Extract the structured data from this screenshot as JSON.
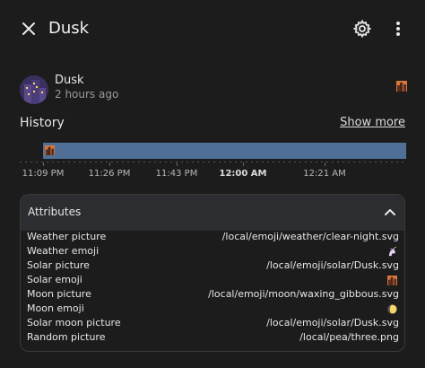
{
  "header": {
    "title": "Dusk",
    "close_icon": "close-icon",
    "settings_icon": "gear-icon",
    "more_icon": "more-vertical-icon"
  },
  "entity": {
    "name": "Dusk",
    "last_changed": "2 hours ago",
    "state_emoji": "city-dusk-emoji"
  },
  "history": {
    "title": "History",
    "show_more": "Show more",
    "bar_color": "#4f6f98",
    "ticks": [
      "11:09 PM",
      "11:26 PM",
      "11:43 PM",
      "12:00 AM",
      "12:21 AM"
    ]
  },
  "attributes": {
    "title": "Attributes",
    "rows": [
      {
        "key": "Weather picture",
        "value": "/local/emoji/weather/clear-night.svg"
      },
      {
        "key": "Weather emoji",
        "value": "",
        "emoji": "unicorn-emoji"
      },
      {
        "key": "Solar picture",
        "value": "/local/emoji/solar/Dusk.svg"
      },
      {
        "key": "Solar emoji",
        "value": "",
        "emoji": "city-dusk-emoji"
      },
      {
        "key": "Moon picture",
        "value": "/local/emoji/moon/waxing_gibbous.svg"
      },
      {
        "key": "Moon emoji",
        "value": "",
        "emoji": "waxing-gibbous-moon-emoji"
      },
      {
        "key": "Solar moon picture",
        "value": "/local/emoji/solar/Dusk.svg"
      },
      {
        "key": "Random picture",
        "value": "/local/pea/three.png"
      }
    ]
  },
  "colors": {
    "background": "#1c1c1c",
    "card_header": "#2b2d31",
    "timeline": "#4f6f98"
  }
}
